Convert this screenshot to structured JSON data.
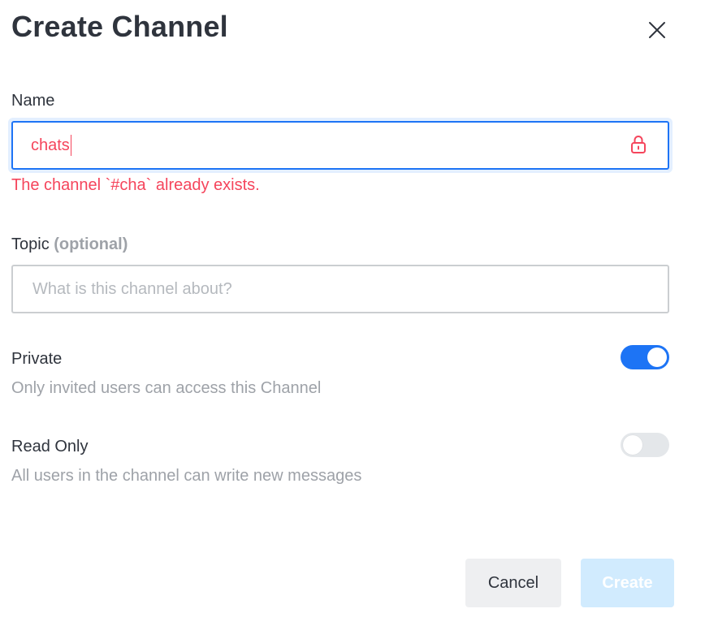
{
  "modal": {
    "title": "Create Channel"
  },
  "name": {
    "label": "Name",
    "value": "chats",
    "error": "The channel `#cha` already exists."
  },
  "topic": {
    "label": "Topic",
    "optional": "(optional)",
    "placeholder": "What is this channel about?",
    "value": ""
  },
  "private": {
    "label": "Private",
    "description": "Only invited users can access this Channel",
    "enabled": true
  },
  "read_only": {
    "label": "Read Only",
    "description": "All users in the channel can write new messages",
    "enabled": false
  },
  "actions": {
    "cancel": "Cancel",
    "create": "Create"
  },
  "icons": {
    "close": "close-icon",
    "lock": "lock-icon"
  },
  "colors": {
    "accent": "#1d74f5",
    "error": "#f5455c",
    "create_disabled": "#d1ebfe"
  }
}
